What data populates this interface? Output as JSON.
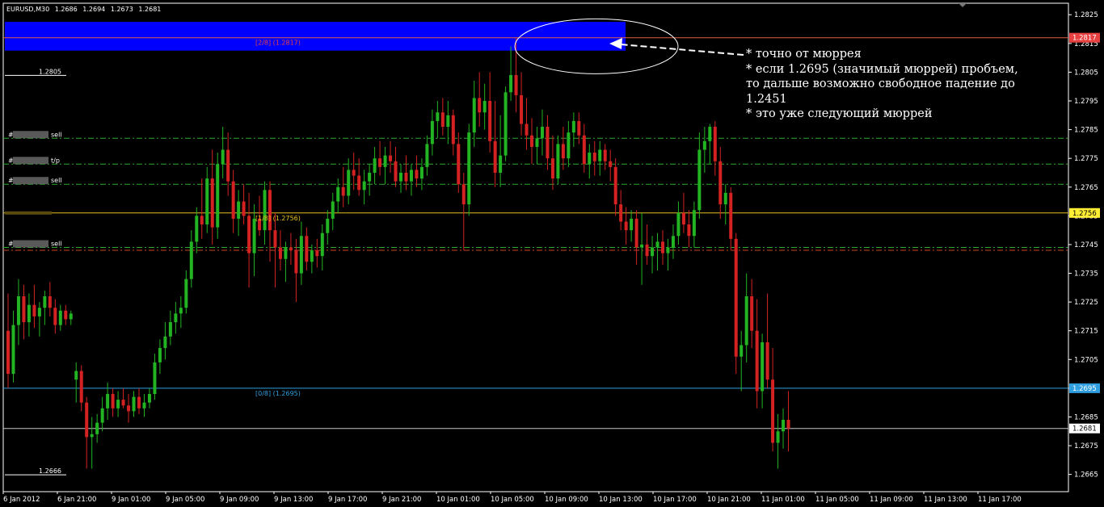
{
  "window": {
    "symbol": "EURUSD,M30",
    "ohlc": [
      "1.2686",
      "1.2694",
      "1.2673",
      "1.2681"
    ]
  },
  "price_axis": {
    "ticks": [
      "1.2825",
      "1.2815",
      "1.2805",
      "1.2795",
      "1.2785",
      "1.2775",
      "1.2765",
      "1.2755",
      "1.2745",
      "1.2735",
      "1.2725",
      "1.2715",
      "1.2705",
      "1.2695",
      "1.2685",
      "1.2675",
      "1.2665"
    ],
    "ticks_values": [
      1.2825,
      1.2815,
      1.2805,
      1.2795,
      1.2785,
      1.2775,
      1.2765,
      1.2755,
      1.2745,
      1.2735,
      1.2725,
      1.2715,
      1.2705,
      1.2695,
      1.2685,
      1.2675,
      1.2665
    ],
    "range": [
      1.2659,
      1.2829
    ]
  },
  "time_axis": {
    "labels": [
      "6 Jan 2012",
      "6 Jan 21:00",
      "9 Jan 01:00",
      "9 Jan 05:00",
      "9 Jan 09:00",
      "9 Jan 13:00",
      "9 Jan 17:00",
      "9 Jan 21:00",
      "10 Jan 01:00",
      "10 Jan 05:00",
      "10 Jan 09:00",
      "10 Jan 13:00",
      "10 Jan 17:00",
      "10 Jan 21:00",
      "11 Jan 01:00",
      "11 Jan 05:00",
      "11 Jan 09:00",
      "11 Jan 13:00",
      "11 Jan 17:00"
    ]
  },
  "price_badges": [
    {
      "value": "1.2817",
      "price": 1.2817,
      "bg": "#e84040",
      "fg": "#ffffff",
      "line": "#e06040"
    },
    {
      "value": "1.2756",
      "price": 1.2756,
      "bg": "#ffee33",
      "fg": "#000000",
      "line": "#e8c020"
    },
    {
      "value": "1.2695",
      "price": 1.2695,
      "bg": "#2f9fe0",
      "fg": "#ffffff",
      "line": "#2f9fe0"
    },
    {
      "value": "1.2681",
      "price": 1.2681,
      "bg": "#ffffff",
      "fg": "#000000",
      "line": "#c8c8c8"
    }
  ],
  "murrey_labels": [
    {
      "text": "[2/8]  (1.2817)",
      "price": 1.2817,
      "color": "#e84040"
    },
    {
      "text": "[1/8]  (1.2756)",
      "price": 1.2756,
      "color": "#e8c020"
    },
    {
      "text": "[0/8]  (1.2695)",
      "price": 1.2695,
      "color": "#2f9fe0"
    }
  ],
  "boxed_levels": [
    {
      "text": "1.2805",
      "price": 1.2805
    },
    {
      "text": "1.2666",
      "price": 1.2666
    }
  ],
  "order_lines": [
    {
      "prefix": "#",
      "suffix": "sell",
      "price": 1.2782,
      "color": "#2ea82e"
    },
    {
      "prefix": "#",
      "suffix": "t/p",
      "price": 1.2773,
      "color": "#2ea82e"
    },
    {
      "prefix": "#",
      "suffix": "sell",
      "price": 1.2766,
      "color": "#2ea82e"
    },
    {
      "prefix": "#",
      "suffix": "sell",
      "price": 1.2744,
      "color": "#2ea82e"
    },
    {
      "prefix": "",
      "suffix": "",
      "price": 1.2743,
      "color": "#d04020"
    }
  ],
  "annotation": [
    "* точно от мюррея",
    "* если 1.2695 (значимый мюррей) пробъем,",
    "то дальше возможно свободное падение до",
    "1.2451",
    "* это уже следующий мюррей"
  ],
  "colors": {
    "bull": "#22b422",
    "bear": "#d42222",
    "highlight": "#0000ff",
    "grid_text": "#ffffff"
  },
  "chart_data": {
    "type": "candlestick",
    "instrument": "EURUSD",
    "timeframe": "M30",
    "candles": [
      [
        1.2715,
        1.2728,
        1.2695,
        1.27
      ],
      [
        1.27,
        1.2722,
        1.2697,
        1.2717
      ],
      [
        1.2717,
        1.2733,
        1.271,
        1.2727
      ],
      [
        1.2727,
        1.2731,
        1.2712,
        1.2718
      ],
      [
        1.2718,
        1.2728,
        1.2713,
        1.2724
      ],
      [
        1.2724,
        1.2731,
        1.2716,
        1.272
      ],
      [
        1.272,
        1.2725,
        1.2713,
        1.2723
      ],
      [
        1.2723,
        1.2729,
        1.2717,
        1.2727
      ],
      [
        1.2727,
        1.2732,
        1.272,
        1.2723
      ],
      [
        1.2723,
        1.2726,
        1.2714,
        1.2717
      ],
      [
        1.2717,
        1.2724,
        1.2715,
        1.2722
      ],
      [
        1.2722,
        1.2724,
        1.2717,
        1.2719
      ],
      [
        1.2719,
        1.2722,
        1.2717,
        1.2721
      ],
      [
        1.2698,
        1.2704,
        1.269,
        1.2701
      ],
      [
        1.2701,
        1.2703,
        1.2687,
        1.269
      ],
      [
        1.269,
        1.2692,
        1.2667,
        1.2678
      ],
      [
        1.2678,
        1.2685,
        1.2667,
        1.2679
      ],
      [
        1.2679,
        1.2686,
        1.2676,
        1.2683
      ],
      [
        1.2683,
        1.2692,
        1.268,
        1.2688
      ],
      [
        1.2688,
        1.2697,
        1.2684,
        1.2693
      ],
      [
        1.2693,
        1.2695,
        1.2685,
        1.2688
      ],
      [
        1.2688,
        1.2694,
        1.2685,
        1.2691
      ],
      [
        1.2691,
        1.2695,
        1.2688,
        1.2689
      ],
      [
        1.2689,
        1.2693,
        1.2683,
        1.2687
      ],
      [
        1.2687,
        1.2694,
        1.2685,
        1.2692
      ],
      [
        1.2692,
        1.2695,
        1.2686,
        1.2688
      ],
      [
        1.2688,
        1.2693,
        1.2685,
        1.269
      ],
      [
        1.269,
        1.2695,
        1.2688,
        1.2693
      ],
      [
        1.2693,
        1.2707,
        1.2691,
        1.2704
      ],
      [
        1.2704,
        1.2712,
        1.27,
        1.2709
      ],
      [
        1.2709,
        1.2718,
        1.2705,
        1.2713
      ],
      [
        1.2713,
        1.2722,
        1.271,
        1.2718
      ],
      [
        1.2718,
        1.2725,
        1.2714,
        1.2721
      ],
      [
        1.2721,
        1.2727,
        1.2716,
        1.2723
      ],
      [
        1.2723,
        1.2736,
        1.2721,
        1.2733
      ],
      [
        1.2733,
        1.275,
        1.273,
        1.2746
      ],
      [
        1.2746,
        1.2758,
        1.2742,
        1.2755
      ],
      [
        1.2755,
        1.2768,
        1.2747,
        1.2752
      ],
      [
        1.2752,
        1.2772,
        1.2749,
        1.2768
      ],
      [
        1.2768,
        1.2778,
        1.2745,
        1.2751
      ],
      [
        1.2751,
        1.2777,
        1.2747,
        1.2773
      ],
      [
        1.2773,
        1.2786,
        1.2768,
        1.2778
      ],
      [
        1.2778,
        1.2784,
        1.2762,
        1.2767
      ],
      [
        1.2767,
        1.2771,
        1.2749,
        1.2754
      ],
      [
        1.2754,
        1.2764,
        1.2748,
        1.276
      ],
      [
        1.276,
        1.2766,
        1.2752,
        1.2755
      ],
      [
        1.2755,
        1.2763,
        1.273,
        1.2742
      ],
      [
        1.2742,
        1.2759,
        1.2734,
        1.2754
      ],
      [
        1.2754,
        1.2762,
        1.2748,
        1.275
      ],
      [
        1.275,
        1.2767,
        1.2745,
        1.2764
      ],
      [
        1.2764,
        1.2767,
        1.2739,
        1.275
      ],
      [
        1.275,
        1.2756,
        1.273,
        1.2744
      ],
      [
        1.2744,
        1.275,
        1.2736,
        1.274
      ],
      [
        1.274,
        1.2746,
        1.2732,
        1.2744
      ],
      [
        1.2744,
        1.2749,
        1.2738,
        1.2743
      ],
      [
        1.2743,
        1.2747,
        1.2725,
        1.2735
      ],
      [
        1.2735,
        1.2753,
        1.2731,
        1.2748
      ],
      [
        1.2748,
        1.2751,
        1.2736,
        1.2739
      ],
      [
        1.2739,
        1.2745,
        1.2735,
        1.2743
      ],
      [
        1.2743,
        1.2747,
        1.2737,
        1.2741
      ],
      [
        1.2741,
        1.2752,
        1.2736,
        1.2749
      ],
      [
        1.2749,
        1.2757,
        1.2745,
        1.2754
      ],
      [
        1.2754,
        1.2763,
        1.275,
        1.276
      ],
      [
        1.276,
        1.2768,
        1.2756,
        1.2765
      ],
      [
        1.2765,
        1.2772,
        1.2758,
        1.2762
      ],
      [
        1.2762,
        1.2775,
        1.2759,
        1.2771
      ],
      [
        1.2771,
        1.2777,
        1.2764,
        1.2769
      ],
      [
        1.2769,
        1.2775,
        1.2762,
        1.2764
      ],
      [
        1.2764,
        1.2771,
        1.2759,
        1.2767
      ],
      [
        1.2767,
        1.2773,
        1.2762,
        1.277
      ],
      [
        1.277,
        1.2779,
        1.2766,
        1.2775
      ],
      [
        1.2775,
        1.2781,
        1.2769,
        1.2772
      ],
      [
        1.2772,
        1.2779,
        1.2766,
        1.2776
      ],
      [
        1.2776,
        1.2781,
        1.277,
        1.2774
      ],
      [
        1.2774,
        1.2779,
        1.2765,
        1.2767
      ],
      [
        1.2767,
        1.2773,
        1.2763,
        1.277
      ],
      [
        1.277,
        1.2776,
        1.2764,
        1.2767
      ],
      [
        1.2767,
        1.2773,
        1.2762,
        1.2771
      ],
      [
        1.2771,
        1.2776,
        1.2765,
        1.2768
      ],
      [
        1.2768,
        1.2775,
        1.2764,
        1.2772
      ],
      [
        1.2772,
        1.2783,
        1.2769,
        1.278
      ],
      [
        1.278,
        1.2792,
        1.2776,
        1.2788
      ],
      [
        1.2788,
        1.2795,
        1.2782,
        1.2791
      ],
      [
        1.2791,
        1.2796,
        1.2783,
        1.2786
      ],
      [
        1.2786,
        1.2795,
        1.278,
        1.279
      ],
      [
        1.279,
        1.2792,
        1.2776,
        1.278
      ],
      [
        1.278,
        1.2784,
        1.2763,
        1.2766
      ],
      [
        1.2766,
        1.277,
        1.2743,
        1.2759
      ],
      [
        1.2759,
        1.2787,
        1.2755,
        1.2784
      ],
      [
        1.2784,
        1.2802,
        1.2779,
        1.2796
      ],
      [
        1.2796,
        1.2805,
        1.2786,
        1.2791
      ],
      [
        1.2791,
        1.2801,
        1.2785,
        1.2795
      ],
      [
        1.2795,
        1.2805,
        1.2777,
        1.2781
      ],
      [
        1.2781,
        1.2795,
        1.2765,
        1.277
      ],
      [
        1.277,
        1.279,
        1.2765,
        1.2776
      ],
      [
        1.2776,
        1.28,
        1.2774,
        1.2798
      ],
      [
        1.2798,
        1.2814,
        1.2795,
        1.2804
      ],
      [
        1.2804,
        1.2817,
        1.2791,
        1.2797
      ],
      [
        1.2797,
        1.2805,
        1.2783,
        1.2787
      ],
      [
        1.2787,
        1.2796,
        1.2778,
        1.2783
      ],
      [
        1.2783,
        1.2789,
        1.2773,
        1.2779
      ],
      [
        1.2779,
        1.2786,
        1.2773,
        1.2782
      ],
      [
        1.2782,
        1.2792,
        1.2776,
        1.2786
      ],
      [
        1.2786,
        1.279,
        1.2771,
        1.2775
      ],
      [
        1.2775,
        1.2783,
        1.2764,
        1.2768
      ],
      [
        1.2768,
        1.2783,
        1.2766,
        1.278
      ],
      [
        1.278,
        1.2786,
        1.2771,
        1.2775
      ],
      [
        1.2775,
        1.2788,
        1.2772,
        1.2784
      ],
      [
        1.2784,
        1.2791,
        1.2779,
        1.2788
      ],
      [
        1.2788,
        1.2791,
        1.278,
        1.2783
      ],
      [
        1.2783,
        1.2787,
        1.277,
        1.2773
      ],
      [
        1.2773,
        1.278,
        1.2768,
        1.2777
      ],
      [
        1.2777,
        1.2781,
        1.2769,
        1.2774
      ],
      [
        1.2774,
        1.2781,
        1.2769,
        1.2778
      ],
      [
        1.2778,
        1.278,
        1.2771,
        1.2774
      ],
      [
        1.2774,
        1.2778,
        1.2767,
        1.2772
      ],
      [
        1.2772,
        1.2775,
        1.2755,
        1.2759
      ],
      [
        1.2759,
        1.2764,
        1.275,
        1.2753
      ],
      [
        1.2753,
        1.2758,
        1.2745,
        1.275
      ],
      [
        1.275,
        1.2757,
        1.2746,
        1.2754
      ],
      [
        1.2754,
        1.2757,
        1.2738,
        1.2744
      ],
      [
        1.2744,
        1.2756,
        1.2731,
        1.2745
      ],
      [
        1.2745,
        1.2752,
        1.2738,
        1.2741
      ],
      [
        1.2741,
        1.2748,
        1.2735,
        1.2744
      ],
      [
        1.2744,
        1.2749,
        1.2736,
        1.2746
      ],
      [
        1.2746,
        1.275,
        1.2738,
        1.2742
      ],
      [
        1.2742,
        1.2747,
        1.2736,
        1.2744
      ],
      [
        1.2744,
        1.2752,
        1.274,
        1.2748
      ],
      [
        1.2748,
        1.276,
        1.2745,
        1.2756
      ],
      [
        1.2756,
        1.2763,
        1.2749,
        1.2752
      ],
      [
        1.2752,
        1.2757,
        1.2744,
        1.2748
      ],
      [
        1.2748,
        1.276,
        1.2744,
        1.2757
      ],
      [
        1.2757,
        1.2784,
        1.2754,
        1.2778
      ],
      [
        1.2778,
        1.2786,
        1.277,
        1.2781
      ],
      [
        1.2781,
        1.2787,
        1.2773,
        1.2786
      ],
      [
        1.2786,
        1.2788,
        1.2769,
        1.2774
      ],
      [
        1.2774,
        1.2779,
        1.2754,
        1.2759
      ],
      [
        1.2759,
        1.2766,
        1.2752,
        1.2763
      ],
      [
        1.2763,
        1.2765,
        1.2743,
        1.2747
      ],
      [
        1.2747,
        1.2749,
        1.27,
        1.2706
      ],
      [
        1.2706,
        1.2715,
        1.2694,
        1.271
      ],
      [
        1.271,
        1.2735,
        1.2704,
        1.2727
      ],
      [
        1.2727,
        1.2733,
        1.2709,
        1.2715
      ],
      [
        1.2715,
        1.2726,
        1.2688,
        1.2694
      ],
      [
        1.2694,
        1.2714,
        1.2688,
        1.2711
      ],
      [
        1.2711,
        1.2728,
        1.2695,
        1.2698
      ],
      [
        1.2698,
        1.2709,
        1.2673,
        1.2676
      ],
      [
        1.2676,
        1.2686,
        1.2667,
        1.268
      ],
      [
        1.268,
        1.2688,
        1.2674,
        1.2684
      ],
      [
        1.2684,
        1.2694,
        1.2673,
        1.2681
      ]
    ]
  }
}
